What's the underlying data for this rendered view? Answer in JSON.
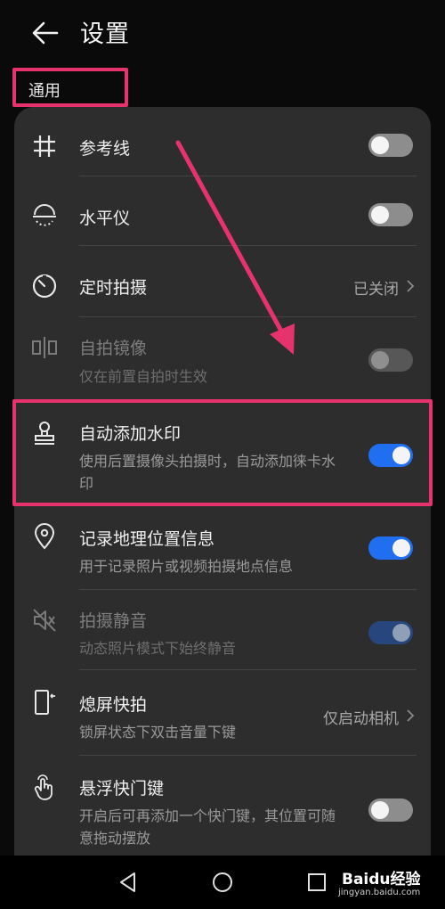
{
  "header": {
    "title": "设置"
  },
  "section": {
    "label": "通用"
  },
  "settings": [
    {
      "label": "参考线",
      "icon": "grid-icon",
      "toggle": "off"
    },
    {
      "label": "水平仪",
      "icon": "level-icon",
      "toggle": "off"
    },
    {
      "label": "定时拍摄",
      "icon": "timer-icon",
      "value": "已关闭"
    },
    {
      "label": "自拍镜像",
      "sub": "仅在前置自拍时生效",
      "icon": "mirror-icon",
      "toggle": "off-disabled"
    },
    {
      "label": "自动添加水印",
      "sub": "使用后置摄像头拍摄时，自动添加徕卡水印",
      "icon": "stamp-icon",
      "toggle": "on"
    },
    {
      "label": "记录地理位置信息",
      "sub": "用于记录照片或视频拍摄地点信息",
      "icon": "location-pin-icon",
      "toggle": "on"
    },
    {
      "label": "拍摄静音",
      "sub": "动态照片模式下始终静音",
      "icon": "mute-icon",
      "toggle": "on-disabled"
    },
    {
      "label": "熄屏快拍",
      "sub": "锁屏状态下双击音量下键",
      "icon": "phone-quick-snap-icon",
      "value": "仅启动相机"
    },
    {
      "label": "悬浮快门键",
      "sub": "开启后可再添加一个快门键，其位置可随意拖动摆放",
      "icon": "touch-hand-icon",
      "toggle": "off"
    }
  ],
  "watermark": {
    "brand": "Baidu经验",
    "url": "jingyan.baidu.com"
  },
  "colors": {
    "accent_toggle": "#1f6ff0",
    "annotation": "#e6336e",
    "card": "#2d2d2d"
  }
}
